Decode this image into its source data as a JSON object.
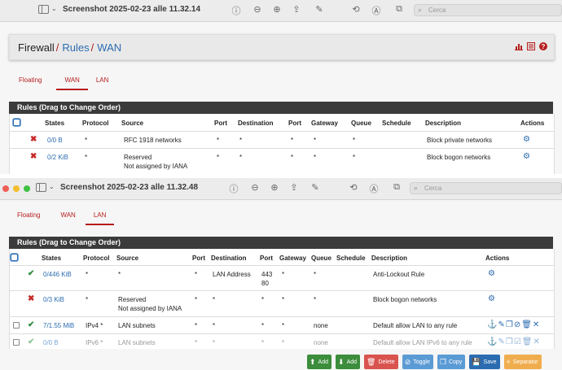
{
  "window1": {
    "title": "Screenshot 2025-02-23 alle 11.32.14",
    "search_placeholder": "Cerca",
    "breadcrumb": {
      "root": "Firewall",
      "sep1": "/",
      "rules": "Rules",
      "sep2": "/",
      "current": "WAN"
    },
    "tabs": [
      "Floating",
      "WAN",
      "LAN"
    ],
    "active_tab": "WAN",
    "panel_title": "Rules (Drag to Change Order)",
    "headers": [
      "States",
      "Protocol",
      "Source",
      "Port",
      "Destination",
      "Port",
      "Gateway",
      "Queue",
      "Schedule",
      "Description",
      "Actions"
    ],
    "rows": [
      {
        "status": "block",
        "states": "0/0 B",
        "protocol": "*",
        "source": "RFC 1918 networks",
        "source2": "",
        "port": "*",
        "destination": "*",
        "dport": "*",
        "gateway": "*",
        "queue": "*",
        "schedule": "",
        "description": "Block private networks"
      },
      {
        "status": "block",
        "states": "0/2 KiB",
        "protocol": "*",
        "source": "Reserved",
        "source2": "Not assigned by IANA",
        "port": "*",
        "destination": "*",
        "dport": "*",
        "gateway": "*",
        "queue": "*",
        "schedule": "",
        "description": "Block bogon networks"
      }
    ]
  },
  "window2": {
    "title": "Screenshot 2025-02-23 alle 11.32.48",
    "search_placeholder": "Cerca",
    "tabs": [
      "Floating",
      "WAN",
      "LAN"
    ],
    "active_tab": "LAN",
    "panel_title": "Rules (Drag to Change Order)",
    "headers": [
      "States",
      "Protocol",
      "Source",
      "Port",
      "Destination",
      "Port",
      "Gateway",
      "Queue",
      "Schedule",
      "Description",
      "Actions"
    ],
    "rows": [
      {
        "status": "pass",
        "states": "0/446 KiB",
        "protocol": "*",
        "source": "*",
        "source2": "",
        "port": "*",
        "destination": "LAN Address",
        "dport": "443",
        "dport2": "80",
        "gateway": "*",
        "queue": "*",
        "schedule": "",
        "description": "Anti-Lockout Rule",
        "checkbox": false,
        "actions": "gear"
      },
      {
        "status": "block",
        "states": "0/3 KiB",
        "protocol": "*",
        "source": "Reserved",
        "source2": "Not assigned by IANA",
        "port": "*",
        "destination": "*",
        "dport": "*",
        "dport2": "",
        "gateway": "*",
        "queue": "*",
        "schedule": "",
        "description": "Block bogon networks",
        "checkbox": false,
        "actions": "gear"
      },
      {
        "status": "pass",
        "states": "7/1.55 MiB",
        "protocol": "IPv4 *",
        "source": "LAN subnets",
        "source2": "",
        "port": "*",
        "destination": "*",
        "dport": "*",
        "dport2": "",
        "gateway": "*",
        "queue": "none",
        "schedule": "",
        "description": "Default allow LAN to any rule",
        "checkbox": true,
        "actions": "full"
      },
      {
        "status": "pass-muted",
        "states": "0/0 B",
        "protocol": "IPv6 *",
        "source": "LAN subnets",
        "source2": "",
        "port": "*",
        "destination": "*",
        "dport": "*",
        "dport2": "",
        "gateway": "*",
        "queue": "none",
        "schedule": "",
        "description": "Default allow LAN IPv6 to any rule",
        "checkbox": true,
        "actions": "full-muted"
      }
    ],
    "buttons": [
      {
        "label": "Add",
        "icon": "arrow-up-icon",
        "color": "#3c8d3c"
      },
      {
        "label": "Add",
        "icon": "arrow-down-icon",
        "color": "#3c8d3c"
      },
      {
        "label": "Delete",
        "icon": "trash-icon",
        "color": "#d9534f"
      },
      {
        "label": "Toggle",
        "icon": "ban-icon",
        "color": "#5b9bd5"
      },
      {
        "label": "Copy",
        "icon": "copy-icon",
        "color": "#5b9bd5"
      },
      {
        "label": "Save",
        "icon": "save-icon",
        "color": "#2b6cb0"
      },
      {
        "label": "Separator",
        "icon": "plus-icon",
        "color": "#f0ad4e"
      }
    ]
  },
  "colors": {
    "accent_red": "#b71c1c",
    "link_blue": "#2b6cb0",
    "panel_header": "#3b3b3b",
    "pass_green": "#2e8b3a",
    "block_red": "#c62828"
  }
}
